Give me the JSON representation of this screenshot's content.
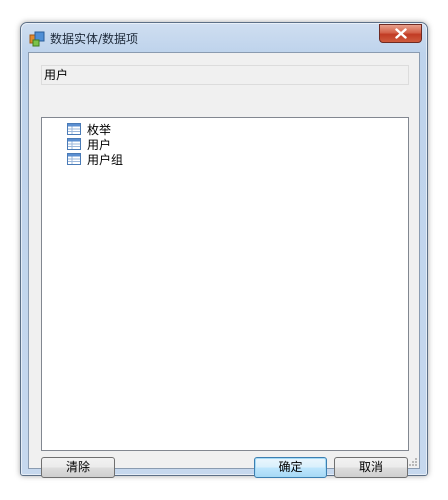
{
  "window": {
    "title": "数据实体/数据项",
    "close_label": "X"
  },
  "path_field": {
    "value": "用户"
  },
  "tree": {
    "items": [
      {
        "label": "枚举",
        "icon": "table-icon"
      },
      {
        "label": "用户",
        "icon": "table-icon"
      },
      {
        "label": "用户组",
        "icon": "table-icon"
      }
    ]
  },
  "buttons": {
    "clear": "清除",
    "ok": "确定",
    "cancel": "取消"
  },
  "colors": {
    "titlebar": "#bed3ec",
    "close": "#c13b24",
    "client": "#f0f0f0",
    "default_button_border": "#3c7fb1"
  }
}
